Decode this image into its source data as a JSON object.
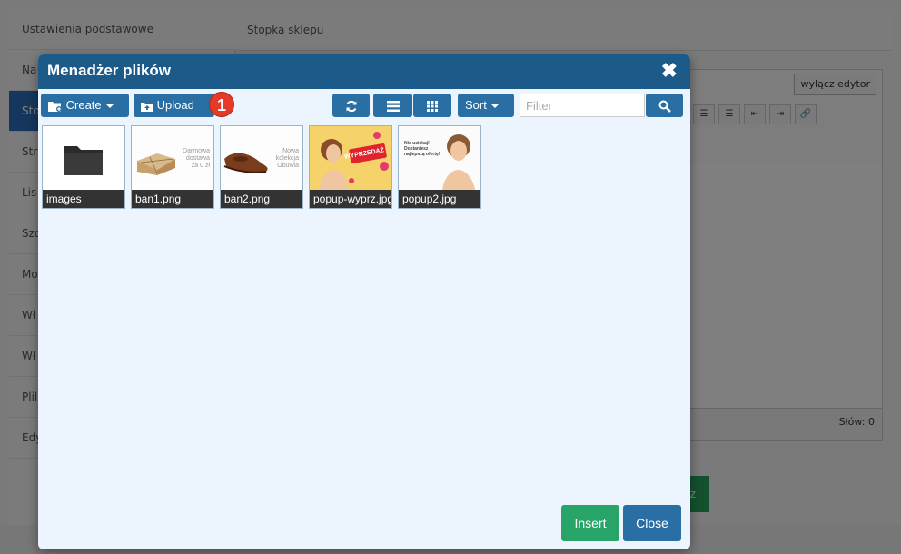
{
  "background": {
    "sidebar_items": [
      {
        "label": "Ustawienia podstawowe",
        "active": false
      },
      {
        "label": "Na",
        "active": false
      },
      {
        "label": "Sto",
        "active": true
      },
      {
        "label": "Str",
        "active": false
      },
      {
        "label": "Lis",
        "active": false
      },
      {
        "label": "Szc",
        "active": false
      },
      {
        "label": "Mo",
        "active": false
      },
      {
        "label": "Wł",
        "active": false
      },
      {
        "label": "Wł",
        "active": false
      },
      {
        "label": "Plil",
        "active": false
      },
      {
        "label": "Edy",
        "active": false
      }
    ],
    "header_title": "Stopka sklepu",
    "editor_toggle": "wyłącz edytor",
    "word_count": "Słów: 0",
    "green_button_fragment": "z"
  },
  "modal": {
    "title": "Menadżer plików",
    "close_glyph": "✖",
    "toolbar": {
      "create_label": "Create",
      "upload_label": "Upload",
      "badge_number": "1",
      "sort_label": "Sort",
      "filter_placeholder": "Filter"
    },
    "files": [
      {
        "name": "images",
        "type": "folder"
      },
      {
        "name": "ban1.png",
        "type": "image",
        "thumb_text": [
          "Darmowa",
          "dostawa",
          "za 0 zł"
        ]
      },
      {
        "name": "ban2.png",
        "type": "image",
        "thumb_text": [
          "Nowa",
          "kolekcja",
          "Obuwia"
        ]
      },
      {
        "name": "popup-wyprz.jpg",
        "type": "image",
        "thumb_text": [
          "WYPRZEDAŻ"
        ]
      },
      {
        "name": "popup2.jpg",
        "type": "image",
        "thumb_text": [
          "Nie uciekaj!",
          "Dostaniesz",
          "najlepszą ofertę!"
        ]
      }
    ],
    "insert_label": "Insert",
    "close_label": "Close"
  },
  "colors": {
    "header": "#1c5a8a",
    "button": "#2a6fa4",
    "insert": "#28a468",
    "badge": "#e53a2a",
    "modal_body": "#ecf5fd"
  }
}
